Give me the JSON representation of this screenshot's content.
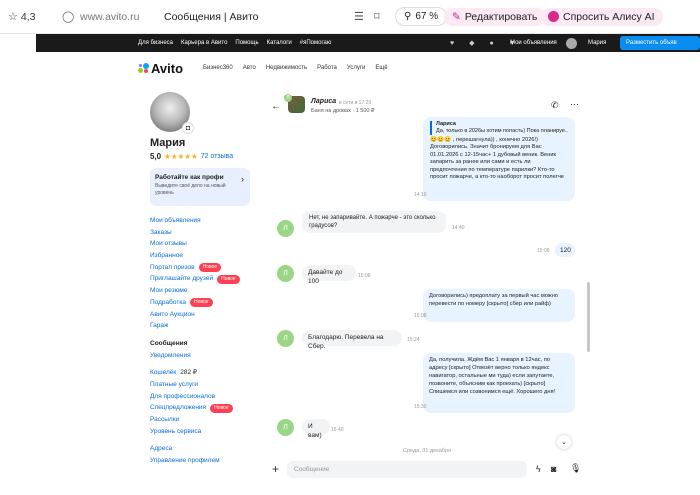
{
  "browser": {
    "rating": "4,3",
    "url": "www.avito.ru",
    "title": "Сообщения | Авито",
    "zoom": "67 %",
    "edit_label": "Редактировать",
    "alice_label": "Спросить Алису AI"
  },
  "topnav": {
    "items": [
      "Для бизнеса",
      "Карьера в Авито",
      "Помощь",
      "Каталоги",
      "#яПомогаю"
    ],
    "my_ads": "Мои объявления",
    "user": "Мария",
    "post_button": "Разместить объяв"
  },
  "logo": {
    "text": "Avito",
    "links": [
      "Бизнес360",
      "Авто",
      "Недвижимость",
      "Работа",
      "Услуги",
      "Ещё"
    ]
  },
  "profile": {
    "name": "Мария",
    "rating": "5,0",
    "stars": "★★★★★",
    "reviews": "72 отзыва",
    "promo_title": "Работайте как профи",
    "promo_text": "Выведите своё дело на новый уровень"
  },
  "sidebar": {
    "links": [
      {
        "label": "Мои объявления",
        "badge": ""
      },
      {
        "label": "Заказы",
        "badge": ""
      },
      {
        "label": "Мои отзывы",
        "badge": ""
      },
      {
        "label": "Избранное",
        "badge": ""
      },
      {
        "label": "Портал призов",
        "badge": "Новое"
      },
      {
        "label": "Приглашайте друзей",
        "badge": "Новое"
      },
      {
        "label": "Мои резюме",
        "badge": ""
      },
      {
        "label": "Подработка",
        "badge": "Новое"
      },
      {
        "label": "Авито Аукцион",
        "badge": ""
      },
      {
        "label": "Гараж",
        "badge": ""
      }
    ],
    "section2_title": "Сообщения",
    "notifications": "Уведомления",
    "wallet_label": "Кошелёк",
    "wallet_value": "282 ₽",
    "links2": [
      {
        "label": "Платные услуги",
        "badge": ""
      },
      {
        "label": "Для профессионалов",
        "badge": ""
      },
      {
        "label": "Спецпредложения",
        "badge": "Новое"
      },
      {
        "label": "Рассылки",
        "badge": ""
      },
      {
        "label": "Уровень сервиса",
        "badge": ""
      }
    ],
    "links3": [
      "Адреса",
      "Управление профилем"
    ]
  },
  "chat": {
    "contact": "Лариса",
    "status": "в сети в 17:29",
    "item": "Баня на дровах · 1 500 ₽",
    "quote_author": "Лариса",
    "quote_text": "Да, только в 2026ы хотим попасть) Пока планируе...",
    "m1_text": "😊😊😊 , перешагнула)) , конечно 2026!)\nДоговорились. Значит бронируем для Вас 01.01.2026 с 12-15час+ 1 дубовый веник. Веник запарить за ранее или сами и есть ли предпочтения по температуре парилки? Кто-то просит пожарче, а кто-то наоборот просит полегче",
    "m1_time": "14:10",
    "m2_text": "Нет, не запаривайте. А пожарче - это сколько градусов?",
    "m2_time": "14:40",
    "m3_text": "120",
    "m3_time": "15:06",
    "m4_text": "Давайте до 100",
    "m4_time": "15:08",
    "m5_text": "Договорились) предоплату за первый час можно перевести по номеру [скрыто] сбер или райф)",
    "m5_time": "15:08",
    "m6_text": "Благодарю. Перевела на Сбер.",
    "m6_time": "15:24",
    "m7_text": "Да, получила. Ждём Вас 1 января в 12час, по адресу [скрыто] Отвезёт верно только яндекс навигатор, остальные ми туда) если запутаете, позвоните, объясним как проехать) [скрыто] Спишемся или созвонимся ещё. Хорошего дня!",
    "m7_time": "15:30",
    "m8_text": "И вам)",
    "m8_time": "15:40",
    "date_sep": "Среда, 31 декабря",
    "input_placeholder": "Сообщение",
    "avatar_letter": "Л"
  },
  "colors": {
    "accent": "#0a6cd6",
    "topnav": "#1a1a1a",
    "out_bubble": "#e7f3ff",
    "in_bubble": "#f2f3f5",
    "avatar": "#9bd687",
    "badge": "#ff4053",
    "star": "#ffb021",
    "promo": "#e8f0ff"
  }
}
